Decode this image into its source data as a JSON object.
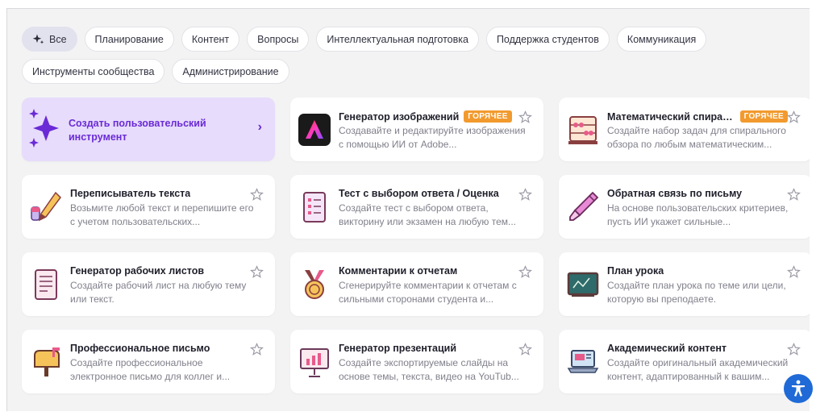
{
  "filters": {
    "row1": [
      {
        "label": "Все",
        "active": true
      },
      {
        "label": "Планирование"
      },
      {
        "label": "Контент"
      },
      {
        "label": "Вопросы"
      },
      {
        "label": "Интеллектуальная подготовка"
      },
      {
        "label": "Поддержка студентов"
      },
      {
        "label": "Коммуникация"
      }
    ],
    "row2": [
      {
        "label": "Инструменты сообщества"
      },
      {
        "label": "Администрирование"
      }
    ]
  },
  "create_tool": {
    "label": "Создать пользовательский инструмент",
    "icon": "sparkle-icon",
    "chevron": "›"
  },
  "hot_label": "ГОРЯЧЕЕ",
  "tools": [
    {
      "title": "Генератор изображений",
      "hot": true,
      "desc": "Создавайте и редактируйте изображения с помощью ИИ от Adobe...",
      "icon": "adobe-logo-icon"
    },
    {
      "title": "Математический спираль...",
      "hot": true,
      "desc": "Создайте набор задач для спирального обзора по любым математическим...",
      "icon": "abacus-icon"
    },
    {
      "title": "Переписыватель текста",
      "desc": "Возьмите любой текст и перепишите его с учетом пользовательских...",
      "icon": "pencil-eraser-icon"
    },
    {
      "title": "Тест с выбором ответа / Оценка",
      "desc": "Создайте тест с выбором ответа, викторину или экзамен на любую тем...",
      "icon": "checklist-document-icon"
    },
    {
      "title": "Обратная связь по письму",
      "desc": "На основе пользовательских критериев, пусть ИИ укажет сильные...",
      "icon": "marker-pen-icon"
    },
    {
      "title": "Генератор рабочих листов",
      "desc": "Создайте рабочий лист на любую тему или текст.",
      "icon": "worksheet-icon"
    },
    {
      "title": "Комментарии к отчетам",
      "desc": "Сгенерируйте комментарии к отчетам с сильными сторонами студента и...",
      "icon": "medal-icon"
    },
    {
      "title": "План урока",
      "desc": "Создайте план урока по теме или цели, которую вы преподаете.",
      "icon": "chalkboard-icon"
    },
    {
      "title": "Профессиональное письмо",
      "desc": "Создайте профессиональное электронное письмо для коллег и...",
      "icon": "mailbox-icon"
    },
    {
      "title": "Генератор презентаций",
      "desc": "Создайте экспортируемые слайды на основе темы, текста, видео на YouTub...",
      "icon": "presentation-board-icon"
    },
    {
      "title": "Академический контент",
      "desc": "Создайте оригинальный академический контент, адаптированный к вашим...",
      "icon": "laptop-icon"
    }
  ],
  "colors": {
    "accent": "#6a2ad6",
    "hot": "#f29a2e",
    "create_bg": "#e7dcfb",
    "a11y": "#1f6ad6"
  }
}
